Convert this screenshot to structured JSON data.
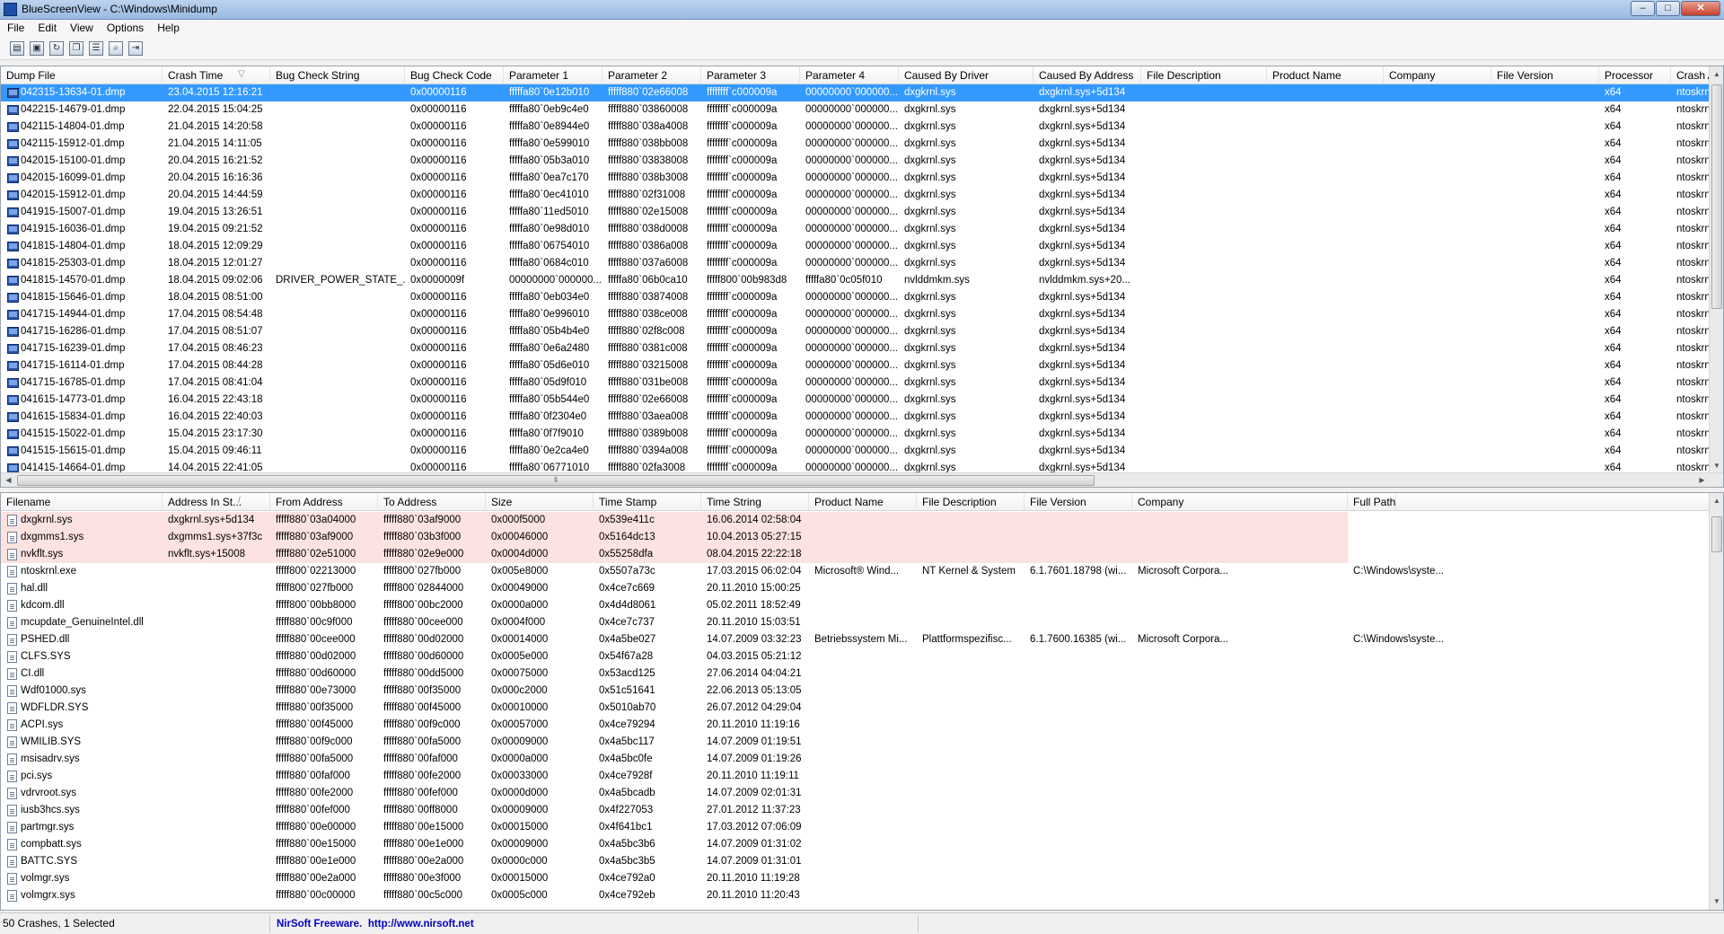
{
  "window": {
    "title": "BlueScreenView  -  C:\\Windows\\Minidump",
    "minimize": "–",
    "maximize": "□",
    "close": "✕"
  },
  "menu": [
    "File",
    "Edit",
    "View",
    "Options",
    "Help"
  ],
  "toolbar": [
    "properties-icon",
    "save-icon",
    "refresh-icon",
    "copy-icon",
    "report-icon",
    "find-icon",
    "exit-icon"
  ],
  "crashes": {
    "columns": [
      "Dump File",
      "Crash Time",
      "Bug Check String",
      "Bug Check Code",
      "Parameter 1",
      "Parameter 2",
      "Parameter 3",
      "Parameter 4",
      "Caused By Driver",
      "Caused By Address",
      "File Description",
      "Product Name",
      "Company",
      "File Version",
      "Processor",
      "Crash A"
    ],
    "sort_indicator": "▽",
    "rows": [
      [
        "042315-13634-01.dmp",
        "23.04.2015 12:16:21",
        "",
        "0x00000116",
        "fffffa80`0e12b010",
        "fffff880`02e66008",
        "ffffffff`c000009a",
        "00000000`000000...",
        "dxgkrnl.sys",
        "dxgkrnl.sys+5d134",
        "",
        "",
        "",
        "",
        "x64",
        "ntoskrn"
      ],
      [
        "042215-14679-01.dmp",
        "22.04.2015 15:04:25",
        "",
        "0x00000116",
        "fffffa80`0eb9c4e0",
        "fffff880`03860008",
        "ffffffff`c000009a",
        "00000000`000000...",
        "dxgkrnl.sys",
        "dxgkrnl.sys+5d134",
        "",
        "",
        "",
        "",
        "x64",
        "ntoskrn"
      ],
      [
        "042115-14804-01.dmp",
        "21.04.2015 14:20:58",
        "",
        "0x00000116",
        "fffffa80`0e8944e0",
        "fffff880`038a4008",
        "ffffffff`c000009a",
        "00000000`000000...",
        "dxgkrnl.sys",
        "dxgkrnl.sys+5d134",
        "",
        "",
        "",
        "",
        "x64",
        "ntoskrn"
      ],
      [
        "042115-15912-01.dmp",
        "21.04.2015 14:11:05",
        "",
        "0x00000116",
        "fffffa80`0e599010",
        "fffff880`038bb008",
        "ffffffff`c000009a",
        "00000000`000000...",
        "dxgkrnl.sys",
        "dxgkrnl.sys+5d134",
        "",
        "",
        "",
        "",
        "x64",
        "ntoskrn"
      ],
      [
        "042015-15100-01.dmp",
        "20.04.2015 16:21:52",
        "",
        "0x00000116",
        "fffffa80`05b3a010",
        "fffff880`03838008",
        "ffffffff`c000009a",
        "00000000`000000...",
        "dxgkrnl.sys",
        "dxgkrnl.sys+5d134",
        "",
        "",
        "",
        "",
        "x64",
        "ntoskrn"
      ],
      [
        "042015-16099-01.dmp",
        "20.04.2015 16:16:36",
        "",
        "0x00000116",
        "fffffa80`0ea7c170",
        "fffff880`038b3008",
        "ffffffff`c000009a",
        "00000000`000000...",
        "dxgkrnl.sys",
        "dxgkrnl.sys+5d134",
        "",
        "",
        "",
        "",
        "x64",
        "ntoskrn"
      ],
      [
        "042015-15912-01.dmp",
        "20.04.2015 14:44:59",
        "",
        "0x00000116",
        "fffffa80`0ec41010",
        "fffff880`02f31008",
        "ffffffff`c000009a",
        "00000000`000000...",
        "dxgkrnl.sys",
        "dxgkrnl.sys+5d134",
        "",
        "",
        "",
        "",
        "x64",
        "ntoskrn"
      ],
      [
        "041915-15007-01.dmp",
        "19.04.2015 13:26:51",
        "",
        "0x00000116",
        "fffffa80`11ed5010",
        "fffff880`02e15008",
        "ffffffff`c000009a",
        "00000000`000000...",
        "dxgkrnl.sys",
        "dxgkrnl.sys+5d134",
        "",
        "",
        "",
        "",
        "x64",
        "ntoskrn"
      ],
      [
        "041915-16036-01.dmp",
        "19.04.2015 09:21:52",
        "",
        "0x00000116",
        "fffffa80`0e98d010",
        "fffff880`038d0008",
        "ffffffff`c000009a",
        "00000000`000000...",
        "dxgkrnl.sys",
        "dxgkrnl.sys+5d134",
        "",
        "",
        "",
        "",
        "x64",
        "ntoskrn"
      ],
      [
        "041815-14804-01.dmp",
        "18.04.2015 12:09:29",
        "",
        "0x00000116",
        "fffffa80`06754010",
        "fffff880`0386a008",
        "ffffffff`c000009a",
        "00000000`000000...",
        "dxgkrnl.sys",
        "dxgkrnl.sys+5d134",
        "",
        "",
        "",
        "",
        "x64",
        "ntoskrn"
      ],
      [
        "041815-25303-01.dmp",
        "18.04.2015 12:01:27",
        "",
        "0x00000116",
        "fffffa80`0684c010",
        "fffff880`037a6008",
        "ffffffff`c000009a",
        "00000000`000000...",
        "dxgkrnl.sys",
        "dxgkrnl.sys+5d134",
        "",
        "",
        "",
        "",
        "x64",
        "ntoskrn"
      ],
      [
        "041815-14570-01.dmp",
        "18.04.2015 09:02:06",
        "DRIVER_POWER_STATE_...",
        "0x0000009f",
        "00000000`000000...",
        "fffffa80`06b0ca10",
        "fffff800`00b983d8",
        "fffffa80`0c05f010",
        "nvlddmkm.sys",
        "nvlddmkm.sys+20...",
        "",
        "",
        "",
        "",
        "x64",
        "ntoskrn"
      ],
      [
        "041815-15646-01.dmp",
        "18.04.2015 08:51:00",
        "",
        "0x00000116",
        "fffffa80`0eb034e0",
        "fffff880`03874008",
        "ffffffff`c000009a",
        "00000000`000000...",
        "dxgkrnl.sys",
        "dxgkrnl.sys+5d134",
        "",
        "",
        "",
        "",
        "x64",
        "ntoskrn"
      ],
      [
        "041715-14944-01.dmp",
        "17.04.2015 08:54:48",
        "",
        "0x00000116",
        "fffffa80`0e996010",
        "fffff880`038ce008",
        "ffffffff`c000009a",
        "00000000`000000...",
        "dxgkrnl.sys",
        "dxgkrnl.sys+5d134",
        "",
        "",
        "",
        "",
        "x64",
        "ntoskrn"
      ],
      [
        "041715-16286-01.dmp",
        "17.04.2015 08:51:07",
        "",
        "0x00000116",
        "fffffa80`05b4b4e0",
        "fffff880`02f8c008",
        "ffffffff`c000009a",
        "00000000`000000...",
        "dxgkrnl.sys",
        "dxgkrnl.sys+5d134",
        "",
        "",
        "",
        "",
        "x64",
        "ntoskrn"
      ],
      [
        "041715-16239-01.dmp",
        "17.04.2015 08:46:23",
        "",
        "0x00000116",
        "fffffa80`0e6a2480",
        "fffff880`0381c008",
        "ffffffff`c000009a",
        "00000000`000000...",
        "dxgkrnl.sys",
        "dxgkrnl.sys+5d134",
        "",
        "",
        "",
        "",
        "x64",
        "ntoskrn"
      ],
      [
        "041715-16114-01.dmp",
        "17.04.2015 08:44:28",
        "",
        "0x00000116",
        "fffffa80`05d6e010",
        "fffff880`03215008",
        "ffffffff`c000009a",
        "00000000`000000...",
        "dxgkrnl.sys",
        "dxgkrnl.sys+5d134",
        "",
        "",
        "",
        "",
        "x64",
        "ntoskrn"
      ],
      [
        "041715-16785-01.dmp",
        "17.04.2015 08:41:04",
        "",
        "0x00000116",
        "fffffa80`05d9f010",
        "fffff880`031be008",
        "ffffffff`c000009a",
        "00000000`000000...",
        "dxgkrnl.sys",
        "dxgkrnl.sys+5d134",
        "",
        "",
        "",
        "",
        "x64",
        "ntoskrn"
      ],
      [
        "041615-14773-01.dmp",
        "16.04.2015 22:43:18",
        "",
        "0x00000116",
        "fffffa80`05b544e0",
        "fffff880`02e66008",
        "ffffffff`c000009a",
        "00000000`000000...",
        "dxgkrnl.sys",
        "dxgkrnl.sys+5d134",
        "",
        "",
        "",
        "",
        "x64",
        "ntoskrn"
      ],
      [
        "041615-15834-01.dmp",
        "16.04.2015 22:40:03",
        "",
        "0x00000116",
        "fffffa80`0f2304e0",
        "fffff880`03aea008",
        "ffffffff`c000009a",
        "00000000`000000...",
        "dxgkrnl.sys",
        "dxgkrnl.sys+5d134",
        "",
        "",
        "",
        "",
        "x64",
        "ntoskrn"
      ],
      [
        "041515-15022-01.dmp",
        "15.04.2015 23:17:30",
        "",
        "0x00000116",
        "fffffa80`0f7f9010",
        "fffff880`0389b008",
        "ffffffff`c000009a",
        "00000000`000000...",
        "dxgkrnl.sys",
        "dxgkrnl.sys+5d134",
        "",
        "",
        "",
        "",
        "x64",
        "ntoskrn"
      ],
      [
        "041515-15615-01.dmp",
        "15.04.2015 09:46:11",
        "",
        "0x00000116",
        "fffffa80`0e2ca4e0",
        "fffff880`0394a008",
        "ffffffff`c000009a",
        "00000000`000000...",
        "dxgkrnl.sys",
        "dxgkrnl.sys+5d134",
        "",
        "",
        "",
        "",
        "x64",
        "ntoskrn"
      ],
      [
        "041415-14664-01.dmp",
        "14.04.2015 22:41:05",
        "",
        "0x00000116",
        "fffffa80`06771010",
        "fffff880`02fa3008",
        "ffffffff`c000009a",
        "00000000`000000...",
        "dxgkrnl.sys",
        "dxgkrnl.sys+5d134",
        "",
        "",
        "",
        "",
        "x64",
        "ntoskrn"
      ]
    ]
  },
  "drivers": {
    "columns": [
      "Filename",
      "Address In St...",
      "From Address",
      "To Address",
      "Size",
      "Time Stamp",
      "Time String",
      "Product Name",
      "File Description",
      "File Version",
      "Company",
      "Full Path"
    ],
    "sort_indicator": "/",
    "rows": [
      [
        "dxgkrnl.sys",
        "dxgkrnl.sys+5d134",
        "fffff880`03a04000",
        "fffff880`03af9000",
        "0x000f5000",
        "0x539e411c",
        "16.06.2014 02:58:04",
        "",
        "",
        "",
        "",
        ""
      ],
      [
        "dxgmms1.sys",
        "dxgmms1.sys+37f3c",
        "fffff880`03af9000",
        "fffff880`03b3f000",
        "0x00046000",
        "0x5164dc13",
        "10.04.2013 05:27:15",
        "",
        "",
        "",
        "",
        ""
      ],
      [
        "nvkflt.sys",
        "nvkflt.sys+15008",
        "fffff880`02e51000",
        "fffff880`02e9e000",
        "0x0004d000",
        "0x55258dfa",
        "08.04.2015 22:22:18",
        "",
        "",
        "",
        "",
        ""
      ],
      [
        "ntoskrnl.exe",
        "",
        "fffff800`02213000",
        "fffff800`027fb000",
        "0x005e8000",
        "0x5507a73c",
        "17.03.2015 06:02:04",
        "Microsoft® Wind...",
        "NT Kernel & System",
        "6.1.7601.18798 (wi...",
        "Microsoft Corpora...",
        "C:\\Windows\\syste..."
      ],
      [
        "hal.dll",
        "",
        "fffff800`027fb000",
        "fffff800`02844000",
        "0x00049000",
        "0x4ce7c669",
        "20.11.2010 15:00:25",
        "",
        "",
        "",
        "",
        ""
      ],
      [
        "kdcom.dll",
        "",
        "fffff800`00bb8000",
        "fffff800`00bc2000",
        "0x0000a000",
        "0x4d4d8061",
        "05.02.2011 18:52:49",
        "",
        "",
        "",
        "",
        ""
      ],
      [
        "mcupdate_GenuineIntel.dll",
        "",
        "fffff880`00c9f000",
        "fffff880`00cee000",
        "0x0004f000",
        "0x4ce7c737",
        "20.11.2010 15:03:51",
        "",
        "",
        "",
        "",
        ""
      ],
      [
        "PSHED.dll",
        "",
        "fffff880`00cee000",
        "fffff880`00d02000",
        "0x00014000",
        "0x4a5be027",
        "14.07.2009 03:32:23",
        "Betriebssystem Mi...",
        "Plattformspezifisc...",
        "6.1.7600.16385 (wi...",
        "Microsoft Corpora...",
        "C:\\Windows\\syste..."
      ],
      [
        "CLFS.SYS",
        "",
        "fffff880`00d02000",
        "fffff880`00d60000",
        "0x0005e000",
        "0x54f67a28",
        "04.03.2015 05:21:12",
        "",
        "",
        "",
        "",
        ""
      ],
      [
        "CI.dll",
        "",
        "fffff880`00d60000",
        "fffff880`00dd5000",
        "0x00075000",
        "0x53acd125",
        "27.06.2014 04:04:21",
        "",
        "",
        "",
        "",
        ""
      ],
      [
        "Wdf01000.sys",
        "",
        "fffff880`00e73000",
        "fffff880`00f35000",
        "0x000c2000",
        "0x51c51641",
        "22.06.2013 05:13:05",
        "",
        "",
        "",
        "",
        ""
      ],
      [
        "WDFLDR.SYS",
        "",
        "fffff880`00f35000",
        "fffff880`00f45000",
        "0x00010000",
        "0x5010ab70",
        "26.07.2012 04:29:04",
        "",
        "",
        "",
        "",
        ""
      ],
      [
        "ACPI.sys",
        "",
        "fffff880`00f45000",
        "fffff880`00f9c000",
        "0x00057000",
        "0x4ce79294",
        "20.11.2010 11:19:16",
        "",
        "",
        "",
        "",
        ""
      ],
      [
        "WMILIB.SYS",
        "",
        "fffff880`00f9c000",
        "fffff880`00fa5000",
        "0x00009000",
        "0x4a5bc117",
        "14.07.2009 01:19:51",
        "",
        "",
        "",
        "",
        ""
      ],
      [
        "msisadrv.sys",
        "",
        "fffff880`00fa5000",
        "fffff880`00faf000",
        "0x0000a000",
        "0x4a5bc0fe",
        "14.07.2009 01:19:26",
        "",
        "",
        "",
        "",
        ""
      ],
      [
        "pci.sys",
        "",
        "fffff880`00faf000",
        "fffff880`00fe2000",
        "0x00033000",
        "0x4ce7928f",
        "20.11.2010 11:19:11",
        "",
        "",
        "",
        "",
        ""
      ],
      [
        "vdrvroot.sys",
        "",
        "fffff880`00fe2000",
        "fffff880`00fef000",
        "0x0000d000",
        "0x4a5bcadb",
        "14.07.2009 02:01:31",
        "",
        "",
        "",
        "",
        ""
      ],
      [
        "iusb3hcs.sys",
        "",
        "fffff880`00fef000",
        "fffff880`00ff8000",
        "0x00009000",
        "0x4f227053",
        "27.01.2012 11:37:23",
        "",
        "",
        "",
        "",
        ""
      ],
      [
        "partmgr.sys",
        "",
        "fffff880`00e00000",
        "fffff880`00e15000",
        "0x00015000",
        "0x4f641bc1",
        "17.03.2012 07:06:09",
        "",
        "",
        "",
        "",
        ""
      ],
      [
        "compbatt.sys",
        "",
        "fffff880`00e15000",
        "fffff880`00e1e000",
        "0x00009000",
        "0x4a5bc3b6",
        "14.07.2009 01:31:02",
        "",
        "",
        "",
        "",
        ""
      ],
      [
        "BATTC.SYS",
        "",
        "fffff880`00e1e000",
        "fffff880`00e2a000",
        "0x0000c000",
        "0x4a5bc3b5",
        "14.07.2009 01:31:01",
        "",
        "",
        "",
        "",
        ""
      ],
      [
        "volmgr.sys",
        "",
        "fffff880`00e2a000",
        "fffff880`00e3f000",
        "0x00015000",
        "0x4ce792a0",
        "20.11.2010 11:19:28",
        "",
        "",
        "",
        "",
        ""
      ],
      [
        "volmgrx.sys",
        "",
        "fffff880`00c00000",
        "fffff880`00c5c000",
        "0x0005c000",
        "0x4ce792eb",
        "20.11.2010 11:20:43",
        "",
        "",
        "",
        "",
        ""
      ]
    ]
  },
  "status": {
    "count": "50 Crashes, 1 Selected",
    "freeware": "NirSoft Freeware.",
    "url": "http://www.nirsoft.net"
  },
  "colors": {
    "selection": "#3399ff",
    "highlight_row": "#fde2e2",
    "link": "#0000c0"
  }
}
